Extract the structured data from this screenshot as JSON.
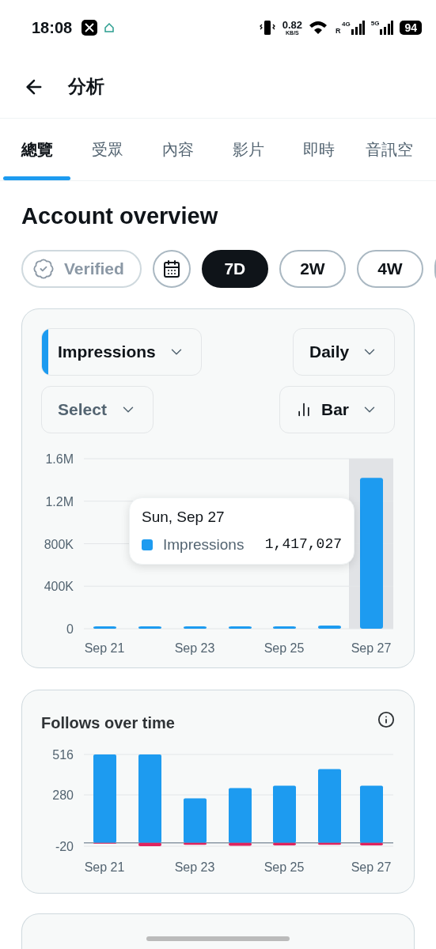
{
  "status_bar": {
    "time": "18:08",
    "network_speed": "0.82",
    "speed_unit": "KB/S",
    "roaming": "R",
    "network_1": "4G",
    "network_2": "5G",
    "battery": "94"
  },
  "header": {
    "title": "分析"
  },
  "tabs": [
    {
      "label": "總覽",
      "selected": true
    },
    {
      "label": "受眾",
      "selected": false
    },
    {
      "label": "內容",
      "selected": false
    },
    {
      "label": "影片",
      "selected": false
    },
    {
      "label": "即時",
      "selected": false
    },
    {
      "label": "音訊空",
      "selected": false
    }
  ],
  "section_title": "Account overview",
  "filters": [
    {
      "kind": "verified",
      "label": "Verified",
      "selected": false
    },
    {
      "kind": "calendar",
      "selected": false
    },
    {
      "kind": "range",
      "label": "7D",
      "selected": true
    },
    {
      "kind": "range",
      "label": "2W",
      "selected": false
    },
    {
      "kind": "range",
      "label": "4W",
      "selected": false
    },
    {
      "kind": "range",
      "selected": false
    }
  ],
  "metric_card": {
    "metric": {
      "label": "Impressions",
      "color": "#1d9bf0"
    },
    "interval": "Daily",
    "compare": "Select",
    "chart_type": "Bar",
    "tooltip": {
      "title": "Sun, Sep 27",
      "value": "1,417,027",
      "color": "#1d9bf0"
    },
    "chart_data": {
      "type": "bar",
      "grid": true,
      "categories": [
        "Sep 21",
        null,
        "Sep 23",
        null,
        "Sep 25",
        null,
        "Sep 27"
      ],
      "series": [
        {
          "name": "Impressions",
          "color": "#1d9bf0",
          "values": [
            12000,
            18000,
            17000,
            14000,
            13000,
            30000,
            1420000
          ]
        }
      ],
      "ylim": [
        0,
        1600000
      ],
      "yticks": [
        {
          "value": 0,
          "label": "0"
        },
        {
          "value": 400000,
          "label": "400K"
        },
        {
          "value": 800000,
          "label": "800K"
        },
        {
          "value": 1200000,
          "label": "1.2M"
        },
        {
          "value": 1600000,
          "label": "1.6M"
        }
      ]
    }
  },
  "follows_card": {
    "title": "Follows over time",
    "chart_data": {
      "type": "bar",
      "stacked": true,
      "grid": true,
      "categories": [
        "Sep 21",
        null,
        "Sep 23",
        null,
        "Sep 25",
        null,
        "Sep 27"
      ],
      "series": [
        {
          "color": "#1d9bf0",
          "values": [
            516,
            516,
            260,
            320,
            333,
            430,
            333
          ]
        },
        {
          "color": "#e0245e",
          "values": [
            -1,
            -20,
            -12,
            -18,
            -15,
            -12,
            -15
          ]
        }
      ],
      "ylim": [
        -20,
        516
      ],
      "yticks": [
        {
          "value": -20,
          "label": "-20"
        },
        {
          "value": 280,
          "label": "280"
        },
        {
          "value": 516,
          "label": "516"
        }
      ]
    }
  }
}
